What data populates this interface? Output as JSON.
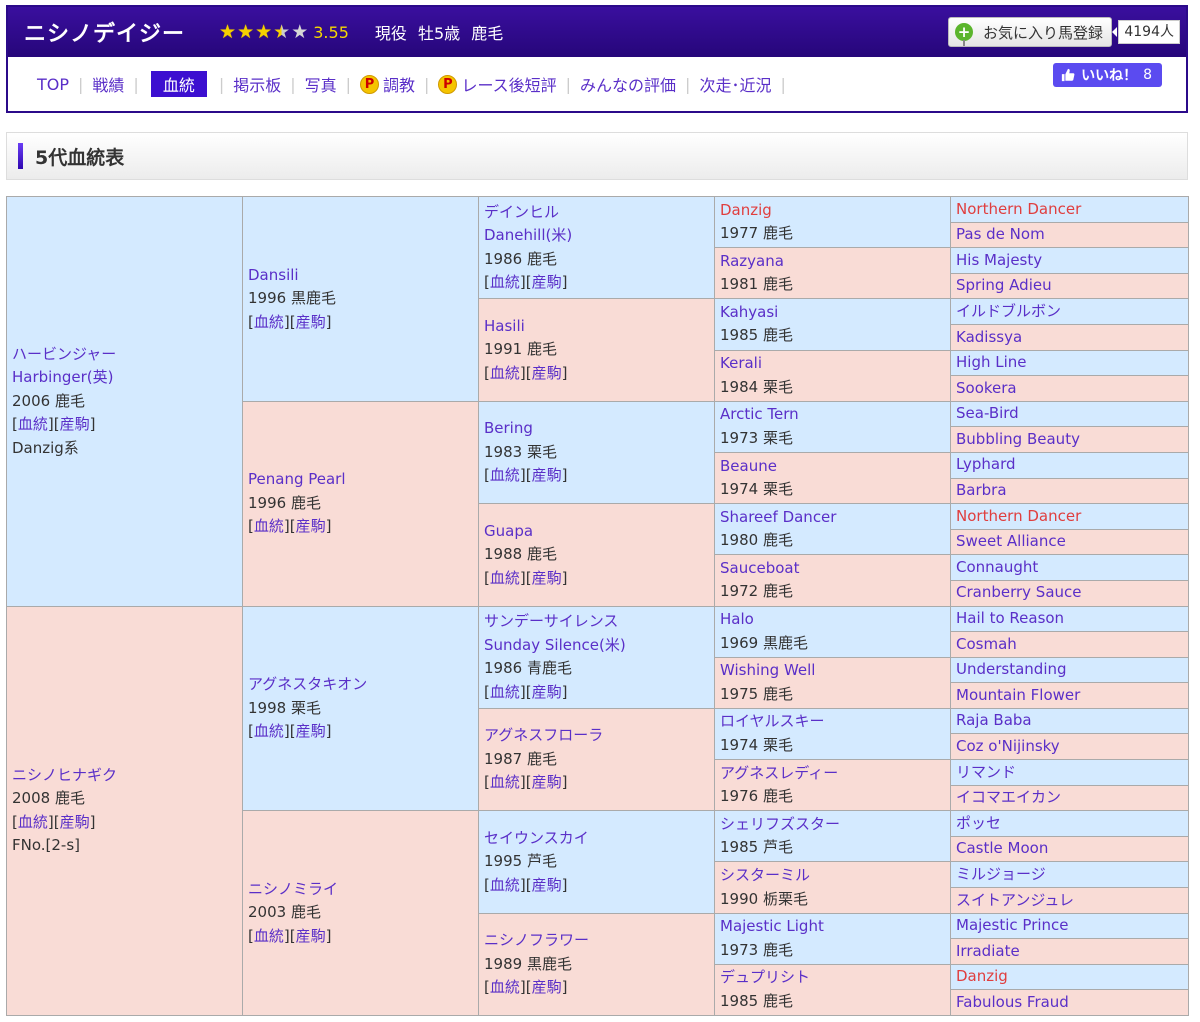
{
  "header": {
    "horse_name": "ニシノデイジー",
    "rating": "3.55",
    "stars": [
      "full",
      "full",
      "full",
      "half",
      "empty"
    ],
    "status": "現役 牡5歳 鹿毛",
    "favorite_label": "お気に入り馬登録",
    "favorite_count": "4194人",
    "like_label": "いいね！",
    "like_count": "8"
  },
  "nav": [
    {
      "label": "TOP",
      "active": false,
      "premium": false
    },
    {
      "label": "戦績",
      "active": false,
      "premium": false
    },
    {
      "label": "血統",
      "active": true,
      "premium": false
    },
    {
      "label": "掲示板",
      "active": false,
      "premium": false
    },
    {
      "label": "写真",
      "active": false,
      "premium": false
    },
    {
      "label": "調教",
      "active": false,
      "premium": true
    },
    {
      "label": "レース後短評",
      "active": false,
      "premium": true
    },
    {
      "label": "みんなの評価",
      "active": false,
      "premium": false
    },
    {
      "label": "次走･近況",
      "active": false,
      "premium": false
    }
  ],
  "section_title": "5代血統表",
  "links": {
    "pedigree": "血統",
    "offspring": "産駒"
  },
  "pedigree": {
    "g1": [
      {
        "name": "ハービンジャー",
        "name2": "Harbinger(英)",
        "info": "2006 鹿毛",
        "extra": "Danzig系",
        "sex": "m"
      },
      {
        "name": "ニシノヒナギク",
        "info": "2008 鹿毛",
        "extra": "FNo.[2-s]",
        "sex": "f"
      }
    ],
    "g2": [
      {
        "name": "Dansili",
        "info": "1996 黒鹿毛",
        "sex": "m"
      },
      {
        "name": "Penang Pearl",
        "info": "1996 鹿毛",
        "sex": "f"
      },
      {
        "name": "アグネスタキオン",
        "info": "1998 栗毛",
        "sex": "m"
      },
      {
        "name": "ニシノミライ",
        "info": "2003 鹿毛",
        "sex": "f"
      }
    ],
    "g3": [
      {
        "name": "デインヒル",
        "name2": "Danehill(米)",
        "info": "1986 鹿毛",
        "sex": "m"
      },
      {
        "name": "Hasili",
        "info": "1991 鹿毛",
        "sex": "f"
      },
      {
        "name": "Bering",
        "info": "1983 栗毛",
        "sex": "m"
      },
      {
        "name": "Guapa",
        "info": "1988 鹿毛",
        "sex": "f"
      },
      {
        "name": "サンデーサイレンス",
        "name2": "Sunday Silence(米)",
        "info": "1986 青鹿毛",
        "sex": "m"
      },
      {
        "name": "アグネスフローラ",
        "info": "1987 鹿毛",
        "sex": "f"
      },
      {
        "name": "セイウンスカイ",
        "info": "1995 芦毛",
        "sex": "m"
      },
      {
        "name": "ニシノフラワー",
        "info": "1989 黒鹿毛",
        "sex": "f"
      }
    ],
    "g4": [
      {
        "name": "Danzig",
        "info": "1977 鹿毛",
        "sex": "m",
        "highlight": true
      },
      {
        "name": "Razyana",
        "info": "1981 鹿毛",
        "sex": "f"
      },
      {
        "name": "Kahyasi",
        "info": "1985 鹿毛",
        "sex": "m"
      },
      {
        "name": "Kerali",
        "info": "1984 栗毛",
        "sex": "f"
      },
      {
        "name": "Arctic Tern",
        "info": "1973 栗毛",
        "sex": "m"
      },
      {
        "name": "Beaune",
        "info": "1974 栗毛",
        "sex": "f"
      },
      {
        "name": "Shareef Dancer",
        "info": "1980 鹿毛",
        "sex": "m"
      },
      {
        "name": "Sauceboat",
        "info": "1972 鹿毛",
        "sex": "f"
      },
      {
        "name": "Halo",
        "info": "1969 黒鹿毛",
        "sex": "m"
      },
      {
        "name": "Wishing Well",
        "info": "1975 鹿毛",
        "sex": "f"
      },
      {
        "name": "ロイヤルスキー",
        "info": "1974 栗毛",
        "sex": "m"
      },
      {
        "name": "アグネスレディー",
        "info": "1976 鹿毛",
        "sex": "f"
      },
      {
        "name": "シェリフズスター",
        "info": "1985 芦毛",
        "sex": "m"
      },
      {
        "name": "シスターミル",
        "info": "1990 栃栗毛",
        "sex": "f"
      },
      {
        "name": "Majestic Light",
        "info": "1973 鹿毛",
        "sex": "m"
      },
      {
        "name": "デュプリシト",
        "info": "1985 鹿毛",
        "sex": "f"
      }
    ],
    "g5": [
      {
        "name": "Northern Dancer",
        "highlight": true
      },
      {
        "name": "Pas de Nom"
      },
      {
        "name": "His Majesty"
      },
      {
        "name": "Spring Adieu"
      },
      {
        "name": "イルドブルボン"
      },
      {
        "name": "Kadissya"
      },
      {
        "name": "High Line"
      },
      {
        "name": "Sookera"
      },
      {
        "name": "Sea-Bird"
      },
      {
        "name": "Bubbling Beauty"
      },
      {
        "name": "Lyphard"
      },
      {
        "name": "Barbra"
      },
      {
        "name": "Northern Dancer",
        "highlight": true
      },
      {
        "name": "Sweet Alliance"
      },
      {
        "name": "Connaught"
      },
      {
        "name": "Cranberry Sauce"
      },
      {
        "name": "Hail to Reason"
      },
      {
        "name": "Cosmah"
      },
      {
        "name": "Understanding"
      },
      {
        "name": "Mountain Flower"
      },
      {
        "name": "Raja Baba"
      },
      {
        "name": "Coz o'Nijinsky"
      },
      {
        "name": "リマンド"
      },
      {
        "name": "イコマエイカン"
      },
      {
        "name": "ポッセ"
      },
      {
        "name": "Castle Moon"
      },
      {
        "name": "ミルジョージ"
      },
      {
        "name": "スイトアンジュレ"
      },
      {
        "name": "Majestic Prince"
      },
      {
        "name": "Irradiate"
      },
      {
        "name": "Danzig",
        "highlight": true
      },
      {
        "name": "Fabulous Fraud"
      }
    ]
  }
}
